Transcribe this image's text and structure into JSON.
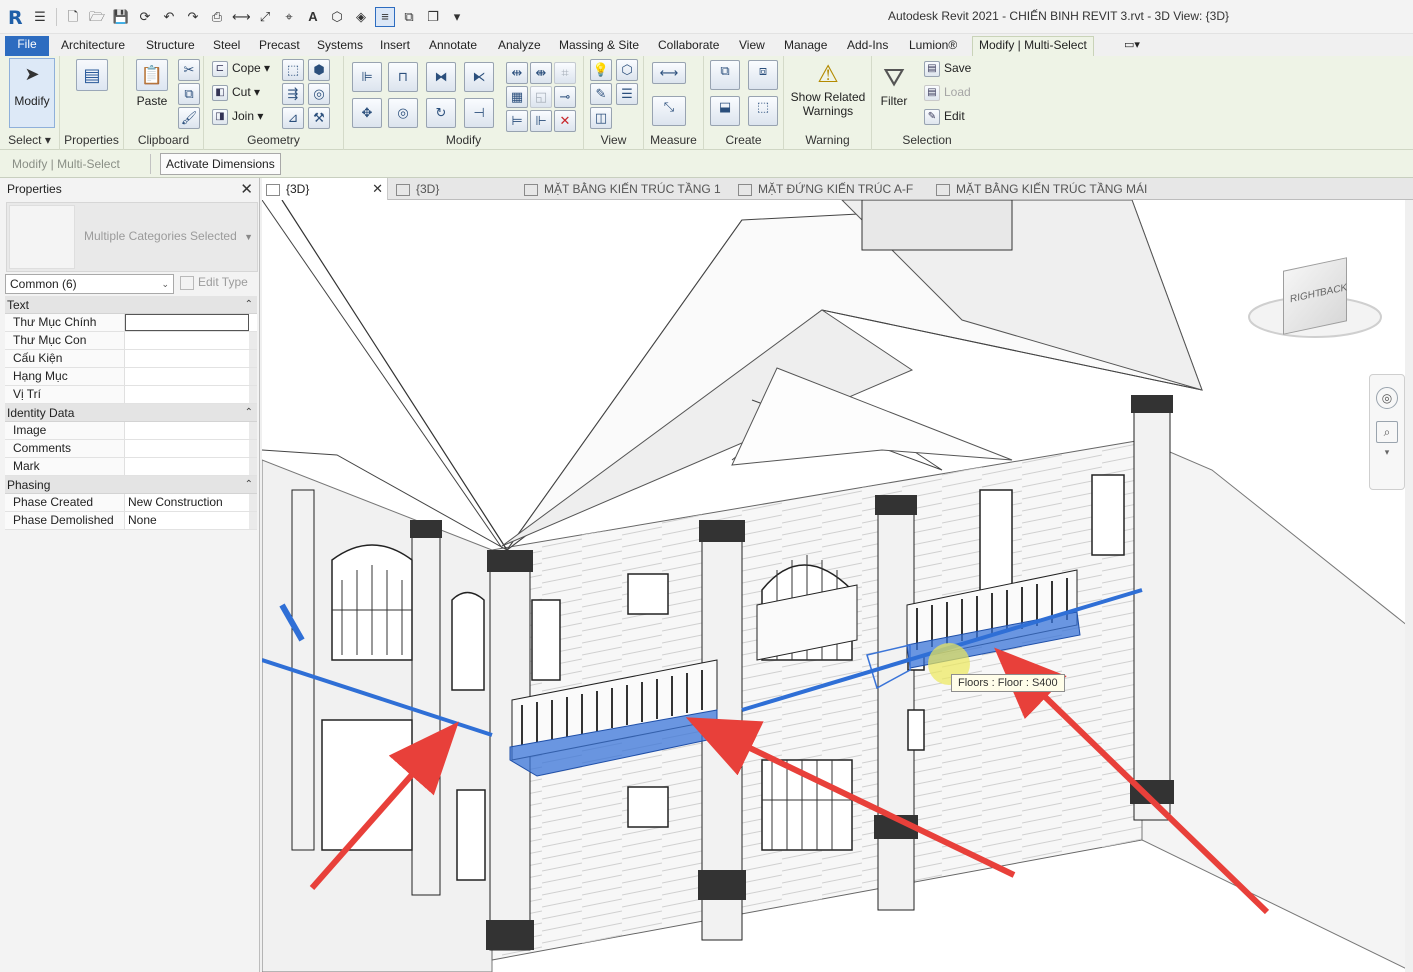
{
  "window": {
    "title": "Autodesk Revit 2021 - CHIẾN BINH REVIT 3.rvt - 3D View: {3D}"
  },
  "ribbon_tabs": [
    "File",
    "Architecture",
    "Structure",
    "Steel",
    "Precast",
    "Systems",
    "Insert",
    "Annotate",
    "Analyze",
    "Massing & Site",
    "Collaborate",
    "View",
    "Manage",
    "Add-Ins",
    "Lumion®",
    "Modify | Multi-Select"
  ],
  "ribbon": {
    "modify_label": "Modify",
    "properties_label": "Properties",
    "paste_label": "Paste",
    "cope_label": "Cope",
    "cut_label": "Cut",
    "join_label": "Join",
    "show_related_line1": "Show Related",
    "show_related_line2": "Warnings",
    "filter_label": "Filter",
    "save_label": "Save",
    "load_label": "Load",
    "edit_label": "Edit",
    "groups": {
      "select": "Select",
      "properties": "Properties",
      "clipboard": "Clipboard",
      "geometry": "Geometry",
      "modify": "Modify",
      "view": "View",
      "measure": "Measure",
      "create": "Create",
      "warning": "Warning",
      "selection": "Selection"
    }
  },
  "options_bar": {
    "context": "Modify | Multi-Select",
    "activate_dimensions": "Activate Dimensions"
  },
  "properties": {
    "title": "Properties",
    "type_selector": "Multiple Categories Selected",
    "filter": "Common (6)",
    "edit_type": "Edit Type",
    "groups": [
      {
        "name": "Text",
        "rows": [
          {
            "key": "Thư Mục Chính",
            "value": ""
          },
          {
            "key": "Thư Mục Con",
            "value": ""
          },
          {
            "key": "Cấu Kiện",
            "value": ""
          },
          {
            "key": "Hạng Mục",
            "value": ""
          },
          {
            "key": "Vị Trí",
            "value": ""
          }
        ]
      },
      {
        "name": "Identity Data",
        "rows": [
          {
            "key": "Image",
            "value": ""
          },
          {
            "key": "Comments",
            "value": ""
          },
          {
            "key": "Mark",
            "value": ""
          }
        ]
      },
      {
        "name": "Phasing",
        "rows": [
          {
            "key": "Phase Created",
            "value": "New Construction"
          },
          {
            "key": "Phase Demolished",
            "value": "None"
          }
        ]
      }
    ]
  },
  "view_tabs": [
    {
      "label": "{3D}",
      "active": true
    },
    {
      "label": "{3D}",
      "active": false
    },
    {
      "label": "MẶT BẰNG KIẾN TRÚC TẦNG 1",
      "active": false
    },
    {
      "label": "MẶT ĐỨNG KIẾN TRÚC A-F",
      "active": false
    },
    {
      "label": "MẶT BẰNG KIẾN TRÚC TẦNG MÁI",
      "active": false
    }
  ],
  "viewport": {
    "tooltip": "Floors : Floor : S400",
    "viewcube_right": "RIGHT",
    "viewcube_back": "BACK"
  },
  "colors": {
    "selection_blue": "#2f6fd6",
    "annotation_arrow": "#e8403a",
    "file_tab": "#2d6cc0",
    "ribbon_bg": "#eef3e6"
  }
}
